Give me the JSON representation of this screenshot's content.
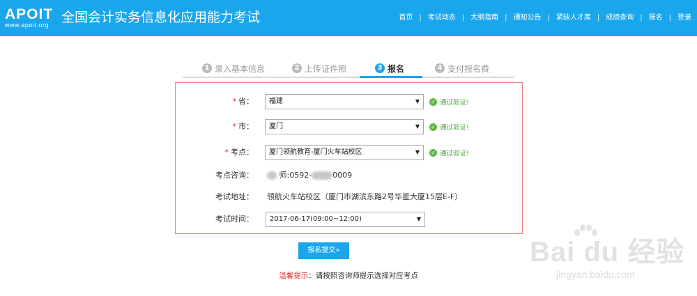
{
  "header": {
    "logo_main": "APOIT",
    "logo_sub": "www.apoit.org",
    "title": "全国会计实务信息化应用能力考试",
    "nav": [
      {
        "label": "首页"
      },
      {
        "label": "考试动态"
      },
      {
        "label": "大纲指南"
      },
      {
        "label": "通知公告"
      },
      {
        "label": "紧缺人才库"
      },
      {
        "label": "成绩查询"
      },
      {
        "label": "报名"
      },
      {
        "label": "登录"
      }
    ]
  },
  "steps": [
    {
      "num": "1",
      "label": "录入基本信息"
    },
    {
      "num": "2",
      "label": "上传证件照"
    },
    {
      "num": "3",
      "label": "报名"
    },
    {
      "num": "4",
      "label": "支付报名费"
    }
  ],
  "form": {
    "required_mark": "*",
    "verify_text": "通过验证!",
    "province": {
      "label": "省：",
      "value": "福建"
    },
    "city": {
      "label": "市：",
      "value": "厦门"
    },
    "exam_site": {
      "label": "考点：",
      "value": "厦门领航教育-厦门火车站校区"
    },
    "consult": {
      "label": "考点咨询：",
      "value_a": "师:0592-",
      "value_b": "0009"
    },
    "address": {
      "label": "考试地址：",
      "value": "领航火车站校区（厦门市湖滨东路2号华星大厦15层E-F）"
    },
    "exam_time": {
      "label": "考试时间：",
      "value": "2017-06-17(09:00~12:00)"
    }
  },
  "submit_label": "报名提交»",
  "tip": {
    "label": "温馨提示",
    "text": "：请按照咨询师提示选择对应考点"
  },
  "watermark": {
    "main": "Bai du 经验",
    "sub": "jingyan.baidu.com"
  },
  "colors": {
    "header": "#1aa6ec",
    "accent": "#1aa6ec",
    "required": "#e03030",
    "success": "#4ca83a",
    "box_border": "#e88080"
  }
}
